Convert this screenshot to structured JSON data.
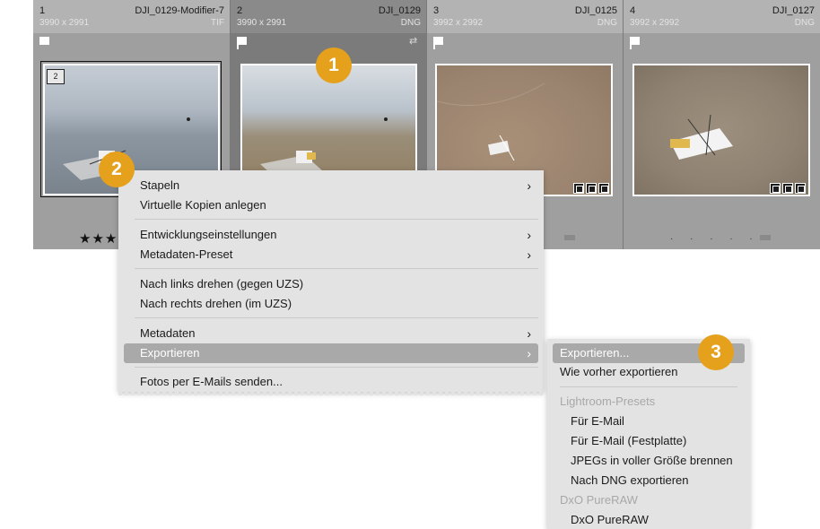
{
  "filmstrip": {
    "cells": [
      {
        "number": "1",
        "name": "DJI_0129-Modifier-7",
        "dimensions": "3990 x 2991",
        "format": "TIF",
        "stack_count": "2",
        "rating": "★★★"
      },
      {
        "number": "2",
        "name": "DJI_0129",
        "dimensions": "3990 x 2991",
        "format": "DNG"
      },
      {
        "number": "3",
        "name": "DJI_0125",
        "dimensions": "3992 x 2992",
        "format": "DNG"
      },
      {
        "number": "4",
        "name": "DJI_0127",
        "dimensions": "3992 x 2992",
        "format": "DNG",
        "rating_dots": "· · · · ·"
      }
    ]
  },
  "callouts": {
    "one": "1",
    "two": "2",
    "three": "3"
  },
  "context_menu": {
    "items": [
      {
        "label": "Stapeln",
        "has_submenu": true
      },
      {
        "label": "Virtuelle Kopien anlegen"
      },
      {
        "label": "Entwicklungseinstellungen",
        "has_submenu": true
      },
      {
        "label": "Metadaten-Preset",
        "has_submenu": true
      },
      {
        "label": "Nach links drehen (gegen UZS)"
      },
      {
        "label": "Nach rechts drehen (im UZS)"
      },
      {
        "label": "Metadaten",
        "has_submenu": true
      },
      {
        "label": "Exportieren",
        "has_submenu": true,
        "highlighted": true
      },
      {
        "label": "Fotos per E-Mails senden..."
      }
    ],
    "arrow": "›"
  },
  "export_submenu": {
    "items": [
      {
        "label": "Exportieren...",
        "highlighted": true
      },
      {
        "label": "Wie vorher exportieren"
      },
      {
        "label": "Lightroom-Presets",
        "header": true
      },
      {
        "label": "Für E-Mail"
      },
      {
        "label": "Für E-Mail (Festplatte)"
      },
      {
        "label": "JPEGs in voller Größe brennen"
      },
      {
        "label": "Nach DNG exportieren"
      },
      {
        "label": "DxO PureRAW",
        "header": true
      },
      {
        "label": "DxO PureRAW"
      }
    ]
  },
  "colors": {
    "callout": "#e5a01c",
    "menu_bg": "#e3e3e3",
    "highlight": "#a9a9a9"
  }
}
